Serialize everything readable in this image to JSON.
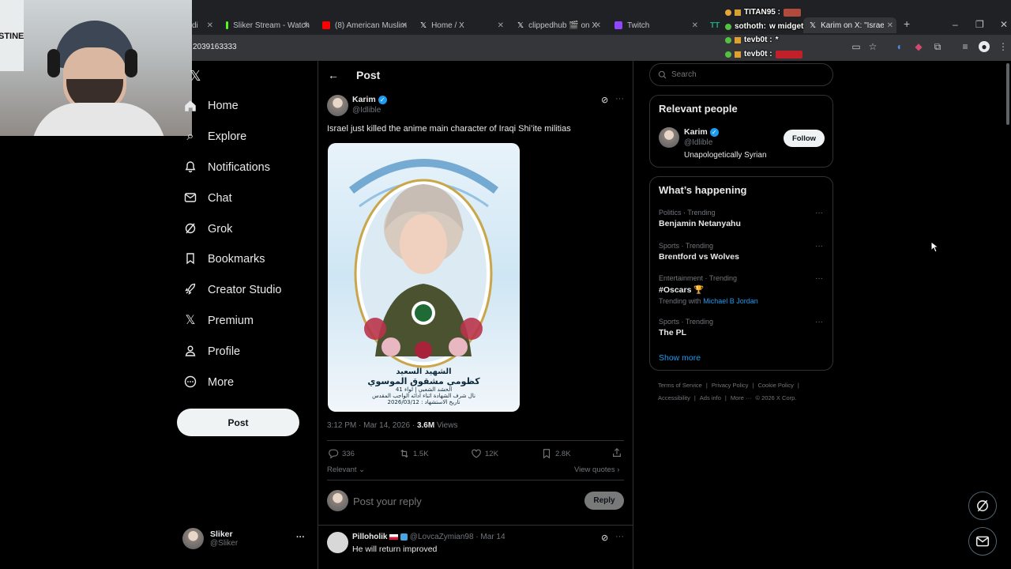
{
  "browser": {
    "tabs": [
      {
        "label": "di",
        "color": "#3c4043"
      },
      {
        "label": "Sliker Stream - Watch",
        "color": "#53fc18"
      },
      {
        "label": "(8) American Muslim",
        "color": "#ff0000"
      },
      {
        "label": "Home / X",
        "color": "#ffffff"
      },
      {
        "label": "clippedhub 🎬 on X",
        "color": "#ffffff"
      },
      {
        "label": "Twitch",
        "color": "#9146ff"
      },
      {
        "label": "TT",
        "color": "#1ea784"
      },
      {
        "label": "Karim on X: \"Israel ju",
        "color": "#ffffff"
      }
    ],
    "url": "2039163333",
    "new_tab": "+"
  },
  "chat_overlay": [
    {
      "user": "TITAN95 :",
      "emote": true
    },
    {
      "user": "sothoth:",
      "message": "w midget"
    },
    {
      "user": "tevb0t :",
      "message": "*"
    },
    {
      "user": "tevb0t :",
      "emote": true
    }
  ],
  "webcam": {
    "shirt_text": "STINE"
  },
  "nav": {
    "items": [
      {
        "label": "Home",
        "icon": "home-icon"
      },
      {
        "label": "Explore",
        "icon": "search-icon"
      },
      {
        "label": "Notifications",
        "icon": "bell-icon"
      },
      {
        "label": "Chat",
        "icon": "envelope-icon"
      },
      {
        "label": "Grok",
        "icon": "grok-icon"
      },
      {
        "label": "Bookmarks",
        "icon": "bookmark-icon"
      },
      {
        "label": "Creator Studio",
        "icon": "rocket-icon"
      },
      {
        "label": "Premium",
        "icon": "x-logo-icon"
      },
      {
        "label": "Profile",
        "icon": "person-icon"
      },
      {
        "label": "More",
        "icon": "more-circle-icon"
      }
    ],
    "post_button": "Post",
    "account": {
      "name": "Sliker",
      "handle": "@Sliker",
      "more": "···"
    }
  },
  "header": {
    "title": "Post",
    "back": "←"
  },
  "post": {
    "author_name": "Karim",
    "author_handle": "@Idlible",
    "text": "Israel just killed the anime main character of Iraqi Shi’ite militias",
    "image": {
      "caption_line1": "الشهيد السعيد",
      "caption_line2": "كظومي مشقوق الموسوي",
      "caption_line3": "الحشد الشعبي | لواء 41",
      "caption_line4": "نال شرف الشهادة اثناء ادائه الواجب المقدس",
      "caption_line5": "تاريخ الاستشهاد : 2026/03/12"
    },
    "time": "3:12 PM · Mar 14, 2026 ·",
    "views_count": "3.6M",
    "views_label": "Views",
    "stats": {
      "replies": "336",
      "reposts": "1.5K",
      "likes": "12K",
      "bookmarks": "2.8K"
    },
    "sort_label": "Relevant",
    "view_quotes": "View quotes",
    "reply_placeholder": "Post your reply",
    "reply_button": "Reply"
  },
  "reply": {
    "name": "Pilloholik",
    "handle": "@LovcaZymian98",
    "date": "· Mar 14",
    "text": "He will return improved"
  },
  "search": {
    "placeholder": "Search"
  },
  "relevant_people": {
    "title": "Relevant people",
    "name": "Karim",
    "handle": "@Idlible",
    "bio": "Unapologetically Syrian",
    "follow": "Follow"
  },
  "whats_happening": {
    "title": "What’s happening",
    "trends": [
      {
        "category": "Politics · Trending",
        "name": "Benjamin Netanyahu",
        "extra_prefix": "",
        "extra_link": ""
      },
      {
        "category": "Sports · Trending",
        "name": "Brentford vs Wolves",
        "extra_prefix": "",
        "extra_link": ""
      },
      {
        "category": "Entertainment · Trending",
        "name": "#Oscars 🏆",
        "extra_prefix": "Trending with",
        "extra_link": "Michael B Jordan"
      },
      {
        "category": "Sports · Trending",
        "name": "The PL",
        "extra_prefix": "",
        "extra_link": ""
      }
    ],
    "show_more": "Show more"
  },
  "footer": {
    "links": [
      "Terms of Service",
      "|",
      "Privacy Policy",
      "|",
      "Cookie Policy",
      "|"
    ],
    "links2": [
      "Accessibility",
      "|",
      "Ads info",
      "|",
      "More ···",
      "© 2026 X Corp."
    ]
  },
  "colors": {
    "accent": "#1d9bf0",
    "background": "#000000",
    "border": "#2f3336",
    "muted": "#71767b"
  }
}
